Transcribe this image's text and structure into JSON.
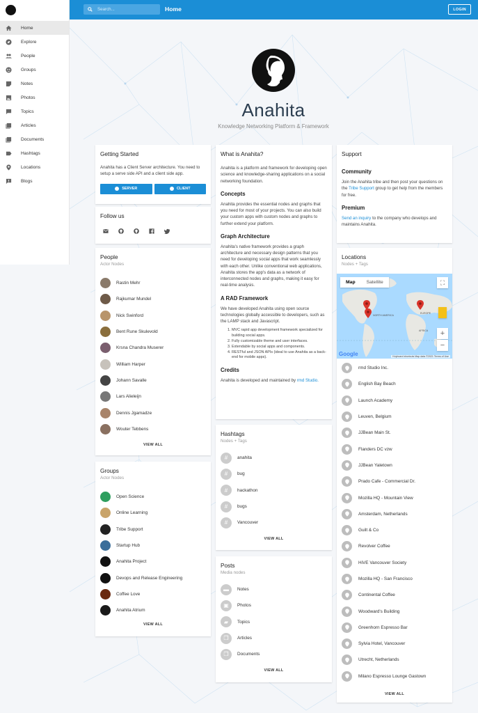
{
  "topbar": {
    "search_placeholder": "Search...",
    "title": "Home",
    "login_label": "LOGIN"
  },
  "sidebar": {
    "items": [
      {
        "label": "Home",
        "icon": "home-icon"
      },
      {
        "label": "Explore",
        "icon": "compass-icon"
      },
      {
        "label": "People",
        "icon": "people-icon"
      },
      {
        "label": "Groups",
        "icon": "groups-icon"
      },
      {
        "label": "Notes",
        "icon": "note-icon"
      },
      {
        "label": "Photos",
        "icon": "photo-icon"
      },
      {
        "label": "Topics",
        "icon": "chat-icon"
      },
      {
        "label": "Articles",
        "icon": "article-icon"
      },
      {
        "label": "Documents",
        "icon": "document-icon"
      },
      {
        "label": "Hashtags",
        "icon": "tag-icon"
      },
      {
        "label": "Locations",
        "icon": "location-icon"
      },
      {
        "label": "Blogs",
        "icon": "blog-icon"
      }
    ]
  },
  "hero": {
    "title": "Anahita",
    "tagline": "Knowledge Networking Platform & Framework"
  },
  "getting_started": {
    "title": "Getting Started",
    "text": "Anahita has a Client Server architecture. You need to setup a serve side API and a client side app.",
    "server_label": "SERVER",
    "client_label": "CLIENT"
  },
  "follow_us": {
    "title": "Follow us",
    "icons": [
      "email-icon",
      "github-icon",
      "github-icon",
      "facebook-icon",
      "twitter-icon"
    ]
  },
  "people": {
    "title": "People",
    "subtitle": "Actor Nodes",
    "items": [
      "Rastin Mehr",
      "Rajkumar Mundel",
      "Nick Swinford",
      "Bent Rune Skulevold",
      "Krsna Chandra Muserer",
      "William Harper",
      "Johann Savalle",
      "Lars Alieleijn",
      "Dennis Jgamadze",
      "Wouter Tebbens"
    ],
    "view_all": "VIEW ALL"
  },
  "groups": {
    "title": "Groups",
    "subtitle": "Actor Nodes",
    "items": [
      "Open Science",
      "Online Learning",
      "Tribe Support",
      "Startup Hub",
      "Anahita Project",
      "Devops and Release Engineering",
      "Coffee Love",
      "Anahita Atrium"
    ],
    "view_all": "VIEW ALL"
  },
  "about": {
    "title": "What is Anahita?",
    "intro": "Anahita is a platform and framework for developing open science and knowledge-sharing applications on a social networking foundation.",
    "concepts_title": "Concepts",
    "concepts": "Anahita provides the essential nodes and graphs that you need for most of your projects. You can also build your custom apps with custom nodes and graphs to further extend your platform.",
    "graph_title": "Graph Architecture",
    "graph": "Anahita's native framework provides a graph architecture and necessary design patterns that you need for developing social apps that work seamlessly with each other. Unlike conventional web applications, Anahita stores the app's data as a network of interconnected nodes and graphs, making it easy for real-time analysis.",
    "rad_title": "A RAD Framework",
    "rad": "We have developed Anahita using open source technologies globally accessible to developers, such as the LAMP stack and Javascript.",
    "rad_list": [
      "MVC rapid app development framework specialized for building social apps.",
      "Fully customizable theme and user interfaces.",
      "Extendable by social apps and components.",
      "RESTful and JSON APIs (ideal to use Anahita as a back-end for mobile apps)."
    ],
    "credits_title": "Credits",
    "credits_text": "Anahita is developed and maintained by",
    "credits_link": "rmd Studio."
  },
  "hashtags": {
    "title": "Hashtags",
    "subtitle": "Nodes + Tags",
    "items": [
      "anahita",
      "bug",
      "hackathon",
      "bugs",
      "Vancouver"
    ],
    "view_all": "VIEW ALL"
  },
  "posts": {
    "title": "Posts",
    "subtitle": "Media nodes",
    "items": [
      "Notes",
      "Photos",
      "Topics",
      "Articles",
      "Documents"
    ],
    "view_all": "VIEW ALL"
  },
  "support": {
    "title": "Support",
    "community_title": "Community",
    "community_pre": "Join the Anahita tribe and then post your questions on the",
    "community_link": "Tribe Support",
    "community_post": "group to get help from the members for free.",
    "premium_title": "Premium",
    "premium_link": "Send an inquiry",
    "premium_post": "to the company who develops and maintains Anahita."
  },
  "locations": {
    "title": "Locations",
    "subtitle": "Nodes + Tags",
    "map_tab": "Map",
    "satellite_tab": "Satellite",
    "map_labels": {
      "north_america": "NORTH AMERICA",
      "europe": "EUROPE",
      "africa": "AFRICA"
    },
    "attribution": "Keyboard shortcuts   Map data ©2021   Terms of Use",
    "google": "Google",
    "items": [
      "rmd Studio Inc.",
      "English Bay Beach",
      "Launch Academy",
      "Leuven, Belgium",
      "JJBean Main St.",
      "Flanders DC vzw",
      "JJBean Yaletown",
      "Prado Cafe - Commercial Dr.",
      "Mozilla HQ - Mountain View",
      "Amsterdam, Netherlands",
      "Guilt & Co",
      "Revolver Coffee",
      "HiVE Vancouver Society",
      "Mozilla HQ - San Francisco",
      "Continental Coffee",
      "Woodward's Building",
      "Greenhorn Espresso Bar",
      "Sylvia Hotel, Vancouver",
      "Utrecht, Netherlands",
      "Milano Espresso Lounge Gastown"
    ],
    "view_all": "VIEW ALL"
  },
  "colors": {
    "accent": "#1b8ed6",
    "background": "#f4f6f9"
  }
}
